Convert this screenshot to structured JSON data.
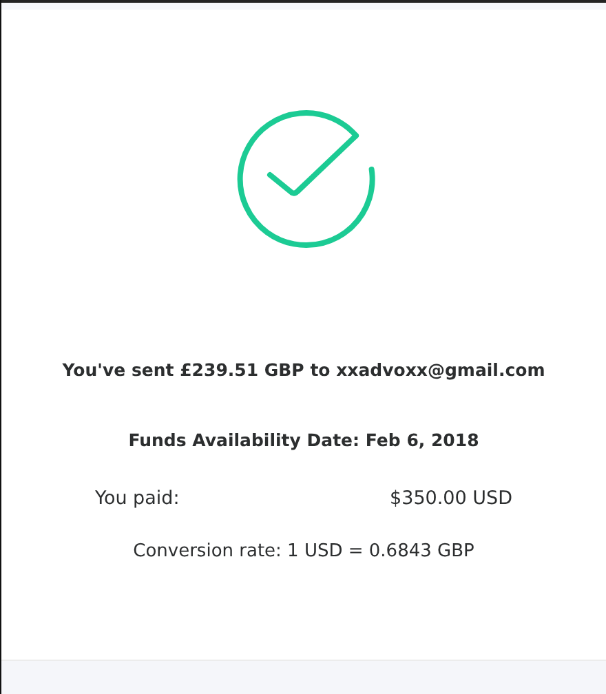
{
  "confirmation": {
    "heading": "You've sent £239.51 GBP to xxadvoxx@gmail.com",
    "availability": "Funds Availability Date: Feb 6, 2018",
    "paid_label": "You paid:",
    "paid_value": "$350.00 USD",
    "conversion": "Conversion rate: 1 USD = 0.6843 GBP"
  }
}
